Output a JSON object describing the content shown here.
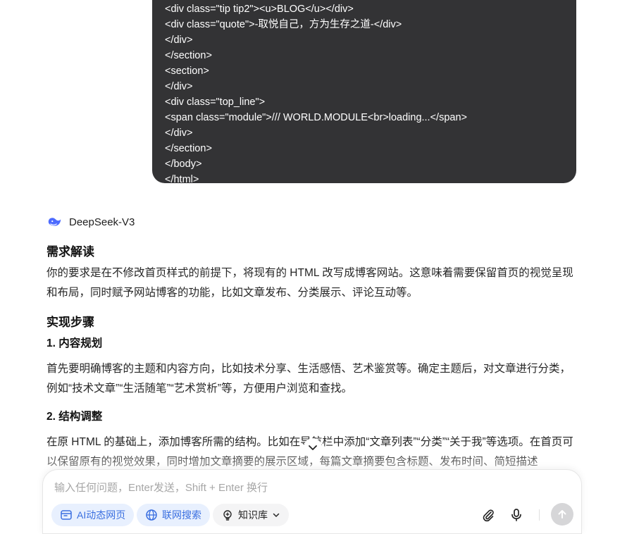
{
  "code_block": {
    "lines": [
      "<div class=\"tip tip2\"><u>BLOG</u></div>",
      "<div class=\"quote\">-取悦自己，方为生存之道-</div>",
      "</div>",
      "</section>",
      "<section>",
      "</div>",
      "<div class=\"top_line\">",
      "<span class=\"module\">/// WORLD.MODULE<br>loading...</span>",
      "</div>",
      "</section>",
      "</body>",
      "</html>"
    ]
  },
  "model": {
    "name": "DeepSeek-V3"
  },
  "answer": {
    "section1_title": "需求解读",
    "section1_text": "你的要求是在不修改首页样式的前提下，将现有的 HTML 改写成博客网站。这意味着需要保留首页的视觉呈现和布局，同时赋予网站博客的功能，比如文章发布、分类展示、评论互动等。",
    "section2_title": "实现步骤",
    "step1_title": "1. 内容规划",
    "step1_text": "首先要明确博客的主题和内容方向，比如技术分享、生活感悟、艺术鉴赏等。确定主题后，对文章进行分类，例如“技术文章”“生活随笔”“艺术赏析”等，方便用户浏览和查找。",
    "step2_title": "2. 结构调整",
    "step2_text": "在原 HTML 的基础上，添加博客所需的结构。比如在导航栏中添加“文章列表”“分类”“关于我”等选项。在首页可以保留原有的视觉效果，同时增加文章摘要的展示区域，每篇文章摘要包含标题、发布时间、简短描述"
  },
  "composer": {
    "placeholder": "输入任何问题，Enter发送，Shift + Enter 换行",
    "chip_ai_webpage": "AI动态网页",
    "chip_web_search": "联网搜索",
    "chip_knowledge": "知识库"
  },
  "colors": {
    "accent": "#3a6fe0",
    "code_bg": "#333335",
    "chip_blue_bg": "#e8f0fe"
  }
}
